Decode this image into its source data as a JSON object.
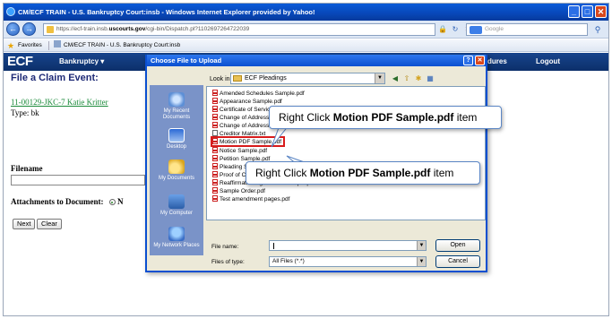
{
  "window": {
    "title": "CM/ECF TRAIN - U.S. Bankruptcy Court:insb - Windows Internet Explorer provided by Yahoo!",
    "controls": [
      "_",
      "□",
      "✕"
    ]
  },
  "address_bar": {
    "url_prefix": "https://ecf-train.insb.",
    "url_domain": "uscourts.gov",
    "url_path": "/cgi-bin/Dispatch.pl?1102697264722039",
    "search_placeholder": "Google"
  },
  "favorites": {
    "label": "Favorites",
    "tab_title": "CM/ECF TRAIN - U.S. Bankruptcy Court:insb"
  },
  "ecf_header": {
    "logo": "ECF",
    "menu": [
      "Bankruptcy",
      "dures",
      "Logout"
    ]
  },
  "page": {
    "title": "File a Claim Event:",
    "case_link": "11-00129-JKC-7 Katie Kritter",
    "type_line": "Type: bk",
    "filename_label": "Filename",
    "attachments_label": "Attachments to Document:",
    "attachments_option": "N",
    "buttons": [
      "Next",
      "Clear"
    ]
  },
  "dialog": {
    "title": "Choose File to Upload",
    "look_in_label": "Look in:",
    "look_in_value": "ECF Pleadings",
    "places": [
      "My Recent Documents",
      "Desktop",
      "My Documents",
      "My Computer",
      "My Network Places"
    ],
    "files": [
      {
        "name": "Amended Schedules Sample.pdf",
        "type": "pdf"
      },
      {
        "name": "Appearance Sample.pdf",
        "type": "pdf"
      },
      {
        "name": "Certificate of Service.pdf",
        "type": "pdf"
      },
      {
        "name": "Change of Address.pdf",
        "type": "pdf"
      },
      {
        "name": "Change of Address 2.pdf",
        "type": "pdf"
      },
      {
        "name": "Creditor Matrix.txt",
        "type": "txt"
      },
      {
        "name": "Motion PDF Sample.pdf",
        "type": "pdf",
        "selected": true
      },
      {
        "name": "Notice Sample.pdf",
        "type": "pdf"
      },
      {
        "name": "Petition Sample.pdf",
        "type": "pdf"
      },
      {
        "name": "Pleading Sample.pdf",
        "type": "pdf"
      },
      {
        "name": "Proof of Claim Sample.pdf",
        "type": "pdf"
      },
      {
        "name": "Reaffirmation Agreement Sample.pdf",
        "type": "pdf"
      },
      {
        "name": "Sample Order.pdf",
        "type": "pdf"
      },
      {
        "name": "Test amendment pages.pdf",
        "type": "pdf"
      }
    ],
    "file_name_label": "File name:",
    "file_name_value": "",
    "files_of_type_label": "Files of type:",
    "files_of_type_value": "All Files (*.*)",
    "open_button": "Open",
    "cancel_button": "Cancel"
  },
  "callouts": [
    {
      "prefix": "Right Click ",
      "bold": "Motion PDF Sample.pdf",
      "suffix": " item"
    },
    {
      "prefix": "Right Click ",
      "bold": "Motion PDF Sample.pdf",
      "suffix": " item"
    }
  ],
  "colors": {
    "ie_title": "#0a4fd0",
    "ecf_header": "#17448c",
    "page_title": "#1e2a76",
    "case_link": "#1a8a3a",
    "highlight": "#d81b1b",
    "places_panel": "#7a93c8",
    "dialog_bg": "#ece9d8"
  }
}
